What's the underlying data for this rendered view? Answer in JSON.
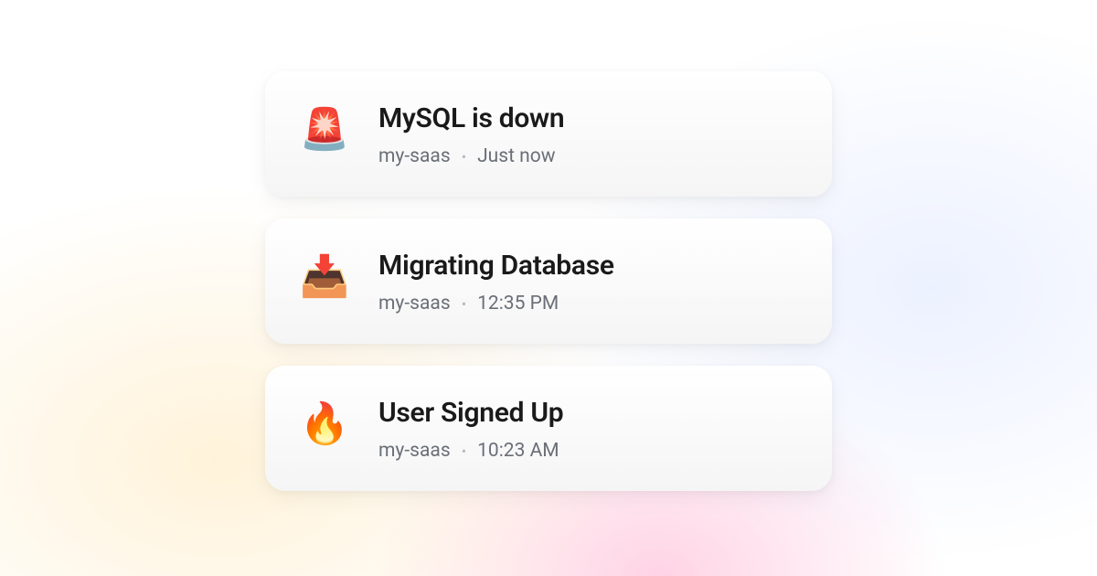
{
  "notifications": [
    {
      "icon": "🚨",
      "icon_name": "siren-icon",
      "title": "MySQL is down",
      "project": "my-saas",
      "time": "Just now"
    },
    {
      "icon": "📥",
      "icon_name": "inbox-download-icon",
      "title": "Migrating Database",
      "project": "my-saas",
      "time": "12:35 PM"
    },
    {
      "icon": "🔥",
      "icon_name": "fire-icon",
      "title": "User Signed Up",
      "project": "my-saas",
      "time": "10:23 AM"
    }
  ]
}
